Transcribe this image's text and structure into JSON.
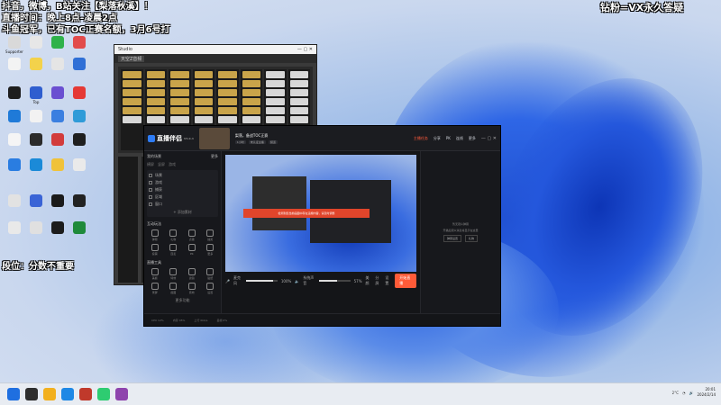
{
  "overlay": {
    "line1": "抖音，微博，B站关注【梨落秋溪】！",
    "line2": "直播时间：晚上8点-凌晨2点",
    "line3": "斗鱼冠军，已有TOC正赛名额，3月6号打",
    "top_right": "钻粉=VX永久答疑",
    "rank": "段位：分数不重要"
  },
  "desktop_icons": [
    {
      "label": "Supporter",
      "color": "#d9d9d9"
    },
    {
      "label": "",
      "color": "#e7e7e7"
    },
    {
      "label": "",
      "color": "#2fb24a"
    },
    {
      "label": "",
      "color": "#e24b4b"
    },
    {
      "label": "",
      "color": "#f3f3f3"
    },
    {
      "label": "",
      "color": "#f3d24b"
    },
    {
      "label": "",
      "color": "#e5e5e5"
    },
    {
      "label": "",
      "color": "#2f6fd6"
    },
    {
      "label": "",
      "color": "#1e1e1e"
    },
    {
      "label": "Top",
      "color": "#2f5ecf"
    },
    {
      "label": "",
      "color": "#6a4fd1"
    },
    {
      "label": "",
      "color": "#e53935"
    },
    {
      "label": "",
      "color": "#1f7ad8"
    },
    {
      "label": "",
      "color": "#f2f2f2"
    },
    {
      "label": "",
      "color": "#3b7fe0"
    },
    {
      "label": "",
      "color": "#2f9bd8"
    },
    {
      "label": "",
      "color": "#f5f5f5"
    },
    {
      "label": "",
      "color": "#2b2b2b"
    },
    {
      "label": "",
      "color": "#d23b3b"
    },
    {
      "label": "",
      "color": "#1f1f1f"
    },
    {
      "label": "",
      "color": "#2a7de1"
    },
    {
      "label": "",
      "color": "#1b8ad8"
    },
    {
      "label": "",
      "color": "#f0c23a"
    },
    {
      "label": "",
      "color": "#eaeaea"
    },
    {
      "label": "",
      "color": "#e2e2e2"
    },
    {
      "label": "",
      "color": "#3a64d6"
    },
    {
      "label": "",
      "color": "#1a1a1a"
    },
    {
      "label": "",
      "color": "#222222"
    },
    {
      "label": "",
      "color": "#e9e9e9"
    },
    {
      "label": "",
      "color": "#e0e0e0"
    },
    {
      "label": "",
      "color": "#1c1c1c"
    },
    {
      "label": "",
      "color": "#1f8a3a"
    }
  ],
  "mixer": {
    "title": "Studio",
    "tabs": [
      "天空Z音频"
    ]
  },
  "app": {
    "name": "直播伴侣",
    "version": "V5.0.4",
    "room_title": "梨落，备战TOC正赛",
    "room_meta": [
      "1小时",
      "未认证主播",
      "频道"
    ],
    "top_links": [
      "主播任务",
      "分享",
      "PK",
      "连线",
      "更多"
    ],
    "left": {
      "header": "我的场景",
      "header_right": "更多",
      "subtabs": [
        "横屏",
        "竖屏",
        "游戏"
      ],
      "scenes": [
        "场景",
        "游戏",
        "捕获",
        "区域",
        "窗口"
      ],
      "add_label": "添加素材",
      "section1": "互动玩法",
      "tools1": [
        "弹幕",
        "礼物",
        "点歌",
        "抽奖",
        "投票",
        "连麦",
        "PK",
        "更多"
      ],
      "section2": "直播工具",
      "tools2": [
        "美颜",
        "特效",
        "滤镜",
        "贴纸",
        "录屏",
        "截图",
        "音效",
        "设置"
      ],
      "more_label": "更多功能"
    },
    "preview_warning": "检测到您当前画面中存在违规内容，请及时调整",
    "controls": {
      "mic_label": "麦克风",
      "mic_value": "100%",
      "mic_level": 0.85,
      "sys_label": "系统声音",
      "sys_value": "57%",
      "sys_level": 0.57,
      "items": [
        "美颜",
        "分屏",
        "设置"
      ],
      "start_button": "开始直播"
    },
    "right": {
      "text": "暂无观众弹幕",
      "sub": "开播后观众消息将显示在这里",
      "buttons": [
        "弹幕设置",
        "礼物"
      ]
    },
    "status": [
      "CPU 12%",
      "内存 45%",
      "上行 0kb/s",
      "丢帧 0%"
    ]
  },
  "taskbar": {
    "time": "20:01",
    "date": "2024/2/14",
    "weather": "2°C",
    "icons": [
      {
        "color": "#1f6fe0"
      },
      {
        "color": "#2e2e2e"
      },
      {
        "color": "#f2b01e"
      },
      {
        "color": "#1e88e5"
      },
      {
        "color": "#c0392b"
      },
      {
        "color": "#2ecc71"
      },
      {
        "color": "#8e44ad"
      }
    ]
  }
}
